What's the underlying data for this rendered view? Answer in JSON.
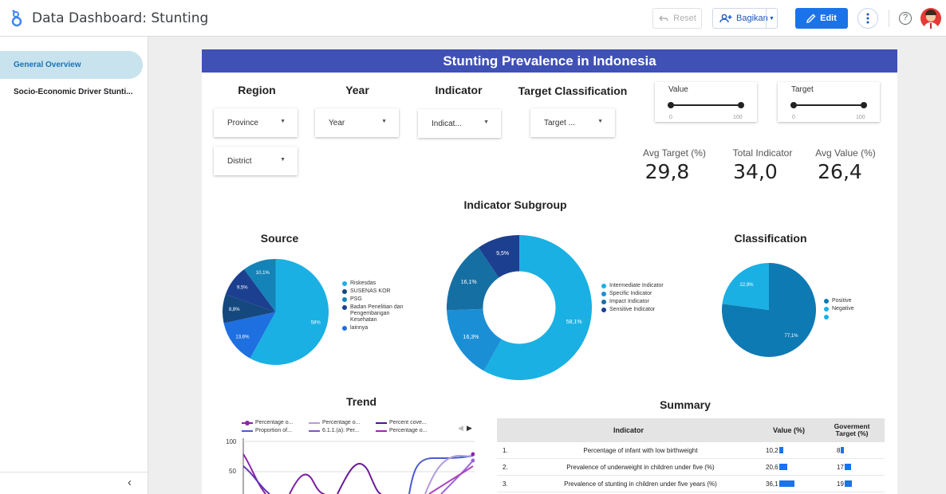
{
  "app": {
    "title": "Data Dashboard: Stunting"
  },
  "toolbar": {
    "reset_label": "Reset",
    "share_label": "Bagikan",
    "edit_label": "Edit"
  },
  "sidebar": {
    "items": [
      {
        "label": "General Overview",
        "active": true
      },
      {
        "label": "Socio-Economic Driver Stunti..."
      }
    ]
  },
  "report": {
    "title": "Stunting Prevalence in Indonesia",
    "controls": {
      "region_label": "Region",
      "year_label": "Year",
      "indicator_label": "Indicator",
      "target_class_label": "Target Classification",
      "province": "Province",
      "district": "District",
      "year": "Year",
      "indicator": "Indicat...",
      "target_class": "Target ..."
    },
    "sliders": [
      {
        "label": "Value",
        "min": "0",
        "max": "100"
      },
      {
        "label": "Target",
        "min": "0",
        "max": "100"
      }
    ],
    "kpis": [
      {
        "label": "Avg Target (%)",
        "value": "29,8"
      },
      {
        "label": "Total Indicator",
        "value": "34,0"
      },
      {
        "label": "Avg Value (%)",
        "value": "26,4"
      }
    ],
    "sections": {
      "subgroup": "Indicator Subgroup",
      "source": "Source",
      "classification": "Classification",
      "trend": "Trend",
      "summary": "Summary"
    }
  },
  "chart_data": [
    {
      "type": "pie",
      "title": "Source",
      "slices": [
        {
          "label": "Riskesdas",
          "value": 58,
          "text": "58%",
          "color": "#1ab0e3"
        },
        {
          "label": "lainnya",
          "value": 13.6,
          "text": "13,6%",
          "color": "#1e6fe0"
        },
        {
          "label": "SUSENAS KOR",
          "value": 8.8,
          "text": "8,8%",
          "color": "#14487f"
        },
        {
          "label": "Badan Penelitian dan Pengembangan Kesehatan",
          "value": 9.5,
          "text": "9,5%",
          "color": "#1c3f8f"
        },
        {
          "label": "PSG",
          "value": 10.1,
          "text": "10,1%",
          "color": "#1483b8"
        }
      ],
      "legend": [
        "Riskesdas",
        "SUSENAS KOR",
        "PSG",
        "Badan Penelitian dan Pengembangan Kesehatan",
        "lainnya"
      ]
    },
    {
      "type": "pie",
      "title": "Indicator Subgroup",
      "slices": [
        {
          "label": "Intermediate Indicator",
          "value": 58.1,
          "text": "58,1%",
          "color": "#1ab0e3"
        },
        {
          "label": "Specific Indicator",
          "value": 16.3,
          "text": "16,3%",
          "color": "#1b8fd6"
        },
        {
          "label": "Impact Indicator",
          "value": 16.1,
          "text": "16,1%",
          "color": "#156fa3"
        },
        {
          "label": "Sensitive Indicator",
          "value": 9.5,
          "text": "9,5%",
          "color": "#1c3f8f"
        }
      ]
    },
    {
      "type": "pie",
      "title": "Classification",
      "slices": [
        {
          "label": "Positive",
          "value": 77.1,
          "text": "77,1%",
          "color": "#0e7ab3"
        },
        {
          "label": "Negative",
          "value": 22.9,
          "text": "22,9%",
          "color": "#1ab0e3"
        }
      ],
      "legend": [
        "Positive",
        "Negative",
        ""
      ]
    },
    {
      "type": "line",
      "title": "Trend",
      "legend": [
        "Percentage o...",
        "Percentage o...",
        "Percent cove...",
        "Proportion of...",
        "6.1.1.(a): Per...",
        "Percentage o..."
      ],
      "yticks": [
        "100",
        "50"
      ]
    },
    {
      "type": "table",
      "title": "Summary",
      "columns": [
        "Indicator",
        "Value (%)",
        "Goverment Target (%)"
      ],
      "rows": [
        {
          "no": "1.",
          "indicator": "Percentage of infant with low birthweight",
          "value": 10.2,
          "value_text": "10,2",
          "target": 8,
          "target_text": "8"
        },
        {
          "no": "2.",
          "indicator": "Prevalence of underweight in children under five (%)",
          "value": 20.6,
          "value_text": "20,6",
          "target": 17,
          "target_text": "17"
        },
        {
          "no": "3.",
          "indicator": "Prevalence of stunting in children under five years (%)",
          "value": 36.1,
          "value_text": "36,1",
          "target": 19,
          "target_text": "19"
        }
      ]
    }
  ]
}
